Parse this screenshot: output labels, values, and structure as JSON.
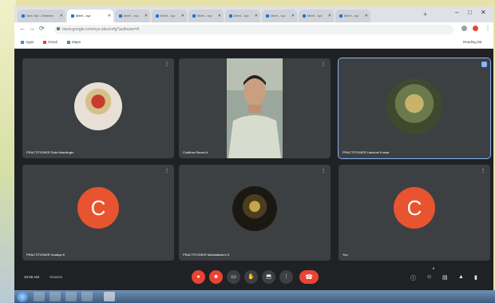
{
  "browser": {
    "tabs": [
      "New Tab - Wheeler",
      "Meet - xyz",
      "Meet - xyz",
      "Meet - xyz",
      "Meet - xyz",
      "Meet - xyz",
      "Meet - xyz",
      "Meet - xyz",
      "Meet - xyz"
    ],
    "new_tab": "+",
    "window_controls": [
      "–",
      "□",
      "✕"
    ],
    "url": "meet.google.com/xyz-abcd-efg?authuser=0",
    "bookmarks": [
      "Apps",
      "Gmail",
      "Maps"
    ],
    "reading_list": "Reading list"
  },
  "participants": [
    {
      "name": "PRACTITIONER Ruth Mandinger",
      "avatar_type": "photo",
      "photo_colors": [
        "#e8e0d6",
        "#c83b2f",
        "#7c8a3a"
      ]
    },
    {
      "name": "Chaithra Ravan A",
      "avatar_type": "video"
    },
    {
      "name": "PRACTITIONER Lakshmi Kumar",
      "avatar_type": "photo",
      "photo_colors": [
        "#6a7a4c",
        "#c9b36a",
        "#3d4a2e"
      ],
      "speaking": true
    },
    {
      "name": "PRACTITIONER Sudaya K",
      "avatar_type": "letter",
      "letter": "C"
    },
    {
      "name": "PRACTITIONER Mahalakshmi S",
      "avatar_type": "photo",
      "photo_colors": [
        "#1b1812",
        "#c9a44a",
        "#4a3d20"
      ]
    },
    {
      "name": "You",
      "avatar_type": "letter",
      "letter": "C"
    }
  ],
  "controls": {
    "time": "10:06 AM",
    "meeting_code": "Classes",
    "buttons": [
      "mic-off-icon",
      "camera-off-icon",
      "captions-icon",
      "raise-hand-icon",
      "present-icon",
      "more-icon"
    ],
    "end_call": "end-call-icon",
    "right_icons": [
      "info-icon",
      "people-icon",
      "chat-icon",
      "activities-icon",
      "lock-icon"
    ],
    "people_count": "6"
  },
  "colors": {
    "accent": "#8ab4f8",
    "end": "#ea4335",
    "avatar": "#e8542f"
  }
}
